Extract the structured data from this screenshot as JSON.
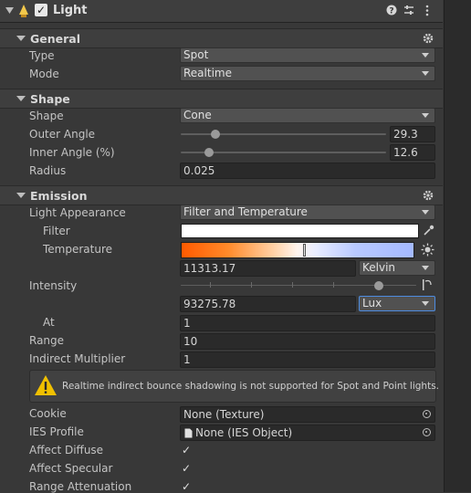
{
  "component": {
    "title": "Light",
    "enabled_check": "✓",
    "help_icon": "help-icon",
    "presets_icon": "presets-icon",
    "menu_icon": "kebab-menu-icon"
  },
  "sections": {
    "general": "General",
    "shape": "Shape",
    "emission": "Emission"
  },
  "general": {
    "type_label": "Type",
    "type_value": "Spot",
    "mode_label": "Mode",
    "mode_value": "Realtime"
  },
  "shape": {
    "shape_label": "Shape",
    "shape_value": "Cone",
    "outer_label": "Outer Angle",
    "outer_value": "29.3",
    "inner_label": "Inner Angle (%)",
    "inner_value": "12.6",
    "radius_label": "Radius",
    "radius_value": "0.025"
  },
  "emission": {
    "appearance_label": "Light Appearance",
    "appearance_value": "Filter and Temperature",
    "filter_label": "Filter",
    "filter_color": "#ffffff",
    "temperature_label": "Temperature",
    "temperature_value": "11313.17",
    "temperature_unit": "Kelvin",
    "intensity_label": "Intensity",
    "intensity_value": "93275.78",
    "intensity_unit": "Lux",
    "at_label": "At",
    "at_value": "1",
    "range_label": "Range",
    "range_value": "10",
    "indirect_label": "Indirect Multiplier",
    "indirect_value": "1",
    "warning_text": "Realtime indirect bounce shadowing is not supported for Spot and Point lights.",
    "cookie_label": "Cookie",
    "cookie_value": "None (Texture)",
    "ies_label": "IES Profile",
    "ies_value": "None (IES Object)",
    "affect_diffuse_label": "Affect Diffuse",
    "affect_diffuse_check": "✓",
    "affect_specular_label": "Affect Specular",
    "affect_specular_check": "✓",
    "range_att_label": "Range Attenuation",
    "range_att_check": "✓"
  },
  "colors": {
    "accent_focus": "#4d8ce0",
    "warning_yellow": "#f0c000"
  }
}
